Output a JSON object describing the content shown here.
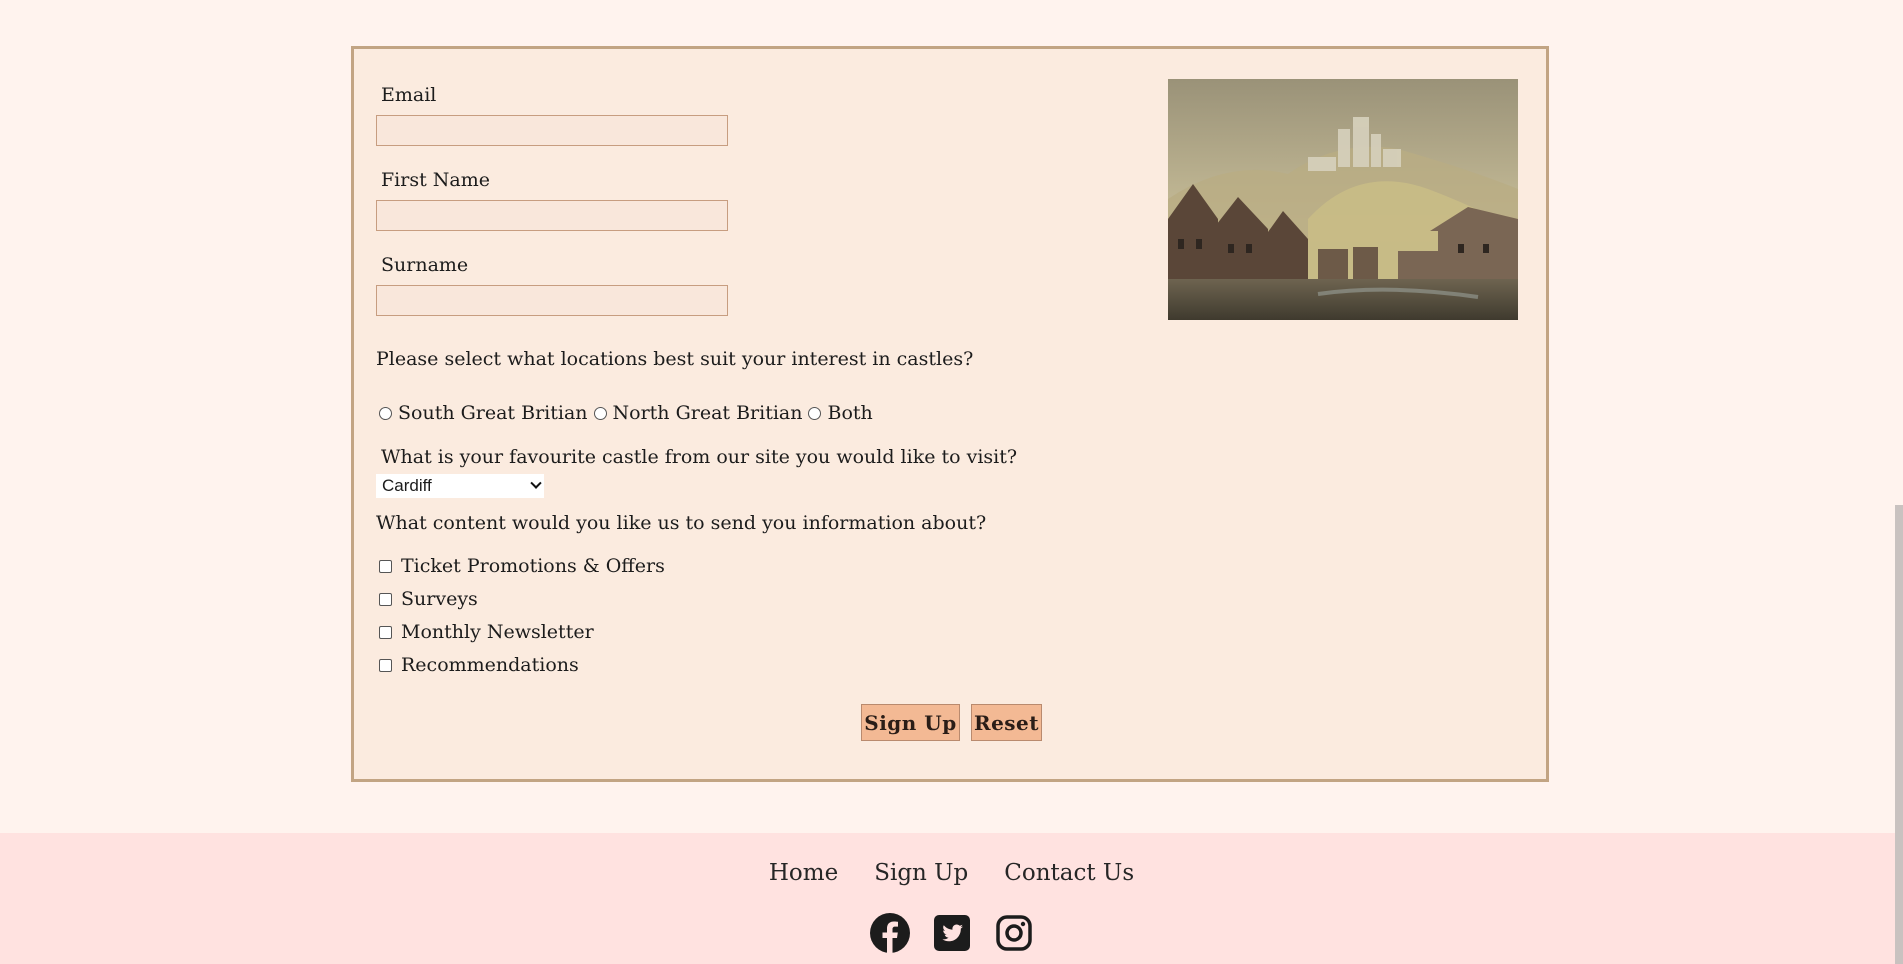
{
  "form": {
    "email_label": "Email",
    "first_name_label": "First Name",
    "surname_label": "Surname",
    "location_question": "Please select what locations best suit your interest in castles?",
    "location_options": [
      "South Great Britian",
      "North Great Britian",
      "Both"
    ],
    "castle_question": "What is your favourite castle from our site you would like to visit?",
    "castle_selected": "Cardiff",
    "content_question": "What content would you like us to send you information about?",
    "content_options": [
      "Ticket Promotions & Offers",
      "Surveys",
      "Monthly Newsletter",
      "Recommendations"
    ],
    "signup_button": "Sign Up",
    "reset_button": "Reset"
  },
  "footer": {
    "nav": [
      "Home",
      "Sign Up",
      "Contact Us"
    ],
    "social": [
      "facebook-icon",
      "twitter-icon",
      "instagram-icon"
    ]
  },
  "colors": {
    "page_bg": "#fff3ee",
    "card_bg": "#fbebdf",
    "card_border": "#c2a483",
    "button_bg": "#f3b994",
    "footer_bg": "#ffe2e0"
  }
}
